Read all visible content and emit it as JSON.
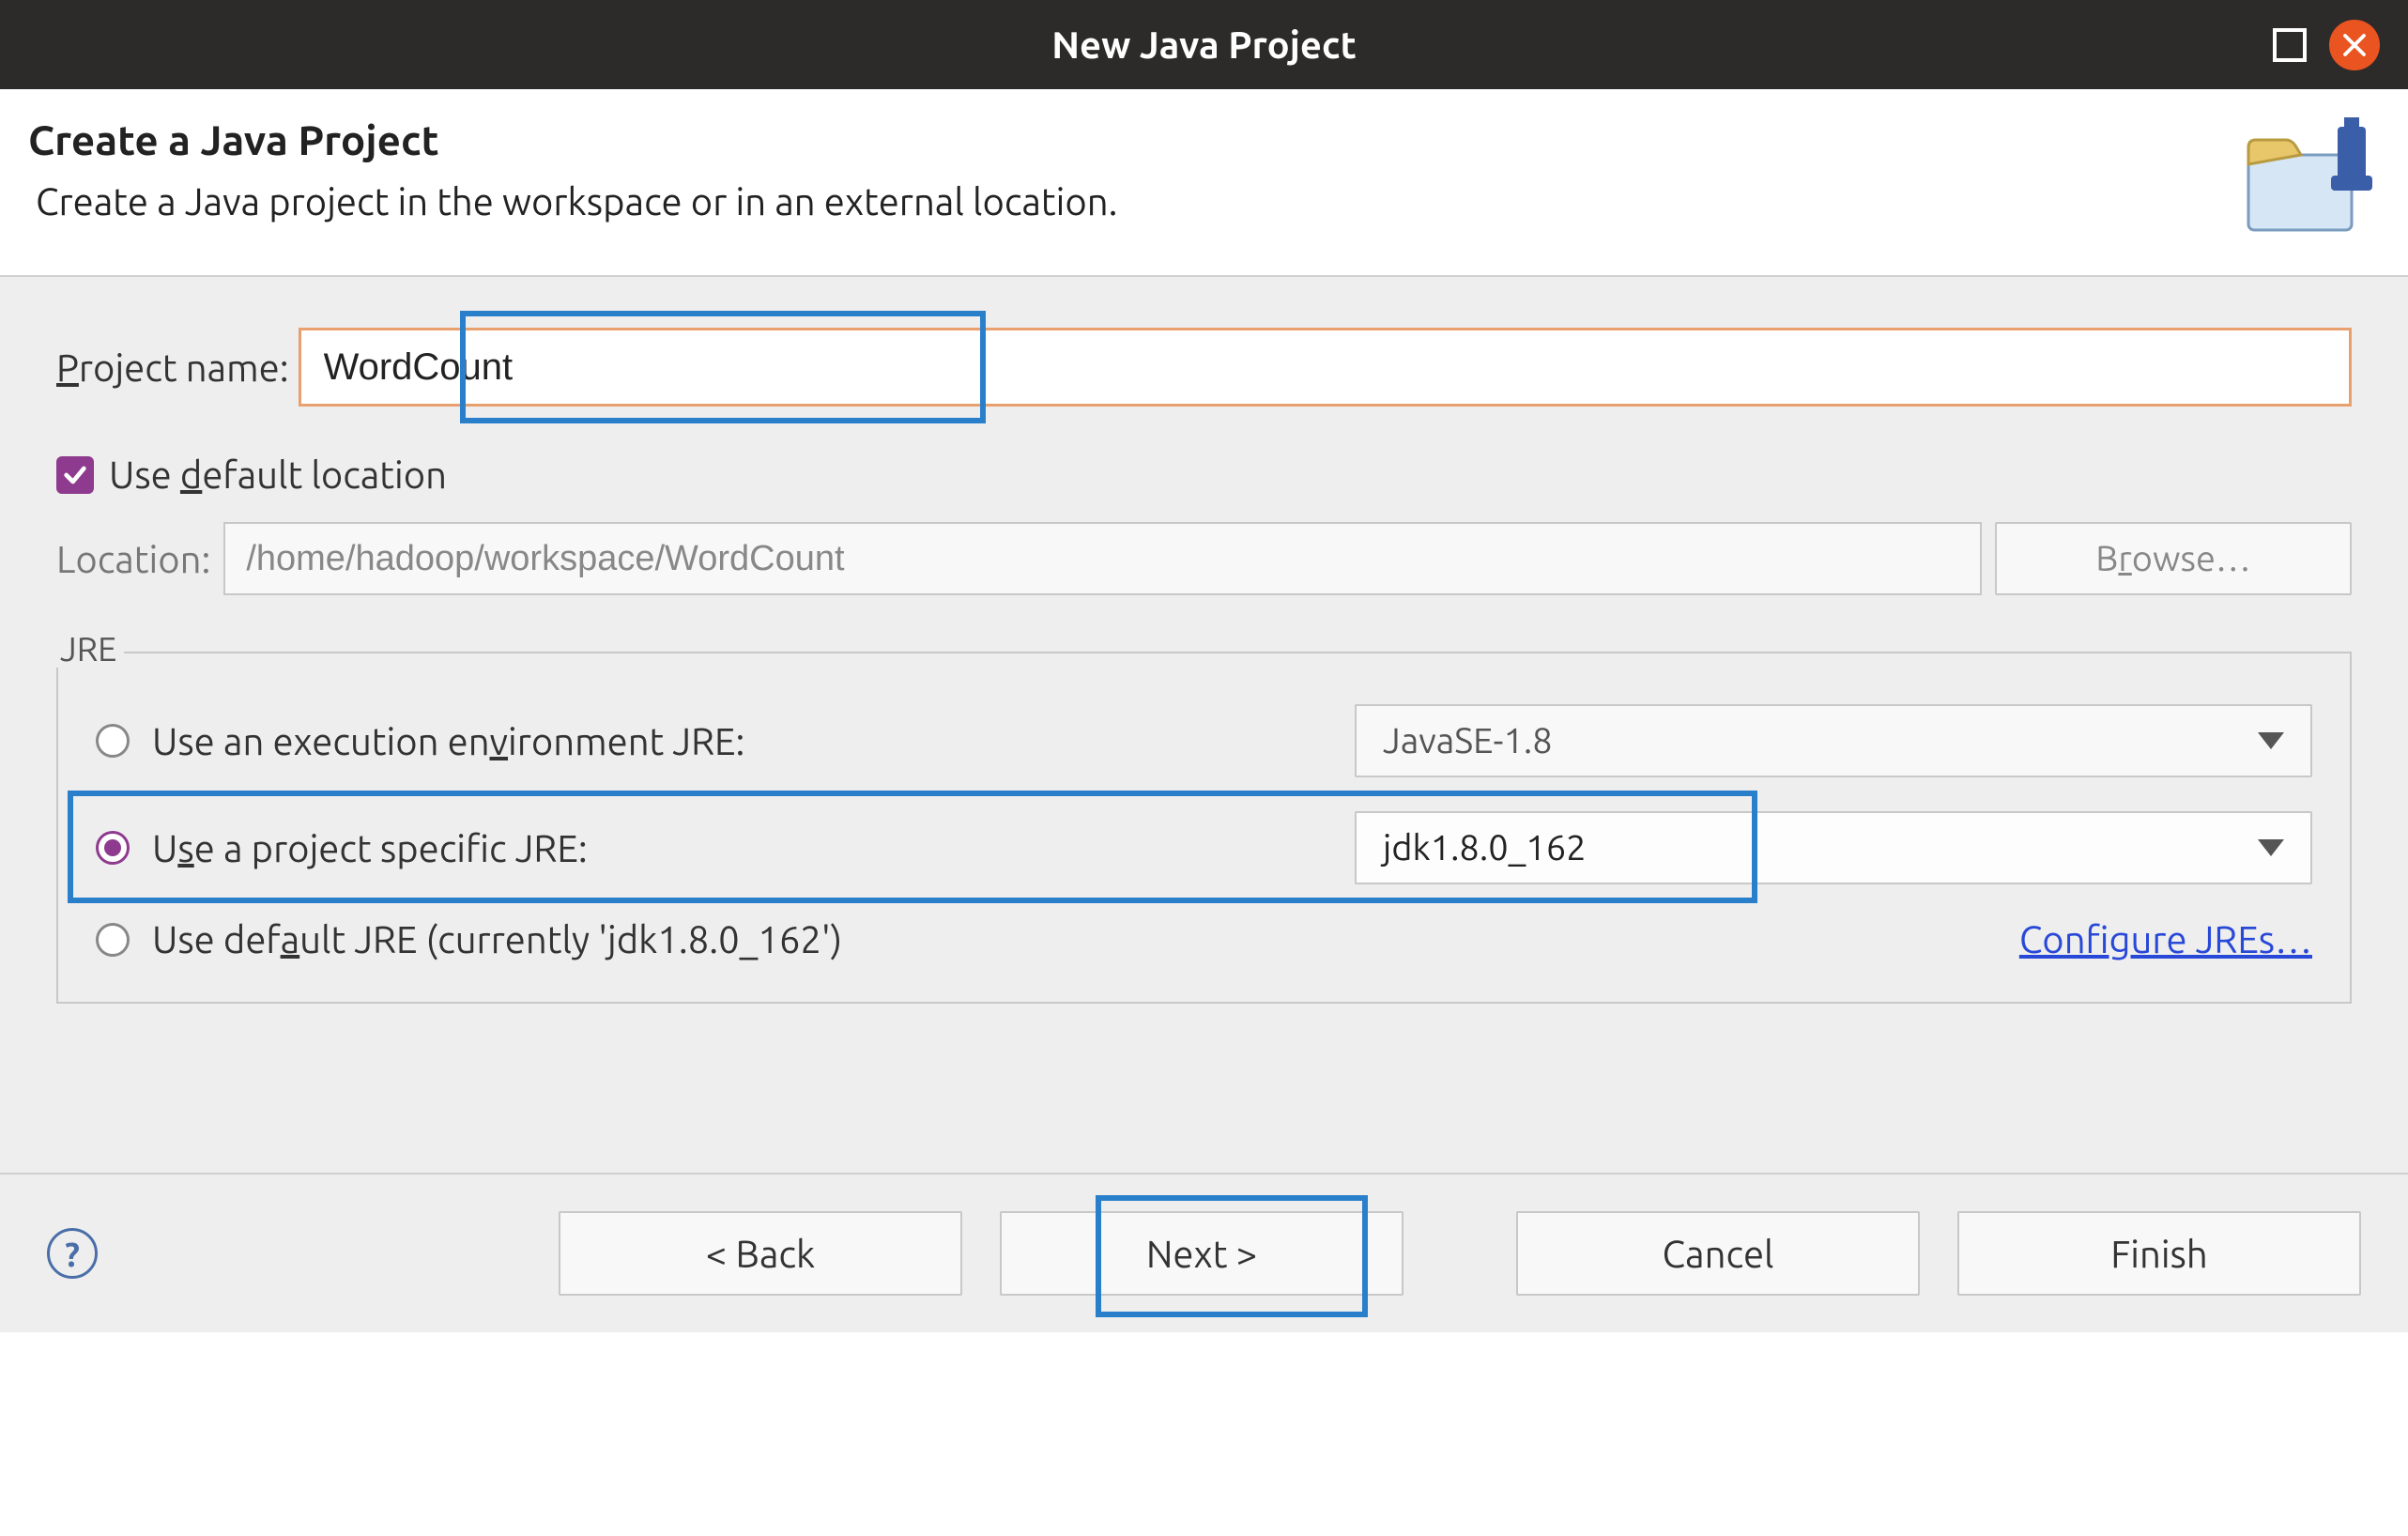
{
  "titlebar": {
    "title": "New Java Project"
  },
  "header": {
    "heading": "Create a Java Project",
    "subheading": "Create a Java project in the workspace or in an external location."
  },
  "project": {
    "label_pre": "P",
    "label_mid": "roject name:",
    "value": "WordCount"
  },
  "default_location": {
    "checked": true,
    "label_pre": "Use ",
    "label_u": "d",
    "label_post": "efault location"
  },
  "location": {
    "label": "Location:",
    "value": "/home/hadoop/workspace/WordCount",
    "browse_pre": "B",
    "browse_u": "r",
    "browse_post": "owse…"
  },
  "jre": {
    "legend": "JRE",
    "env": {
      "label_pre": "Use an execution en",
      "label_u": "v",
      "label_post": "ironment JRE:",
      "value": "JavaSE-1.8"
    },
    "specific": {
      "label_pre": "U",
      "label_u": "s",
      "label_post": "e a project specific JRE:",
      "value": "jdk1.8.0_162"
    },
    "default": {
      "label_pre": "Use def",
      "label_u": "a",
      "label_post": "ult JRE (currently 'jdk1.8.0_162')"
    },
    "configure_pre": "Confi",
    "configure_u": "g",
    "configure_post": "ure JREs…"
  },
  "footer": {
    "back": "< Back",
    "next": "Next >",
    "cancel": "Cancel",
    "finish": "Finish"
  }
}
